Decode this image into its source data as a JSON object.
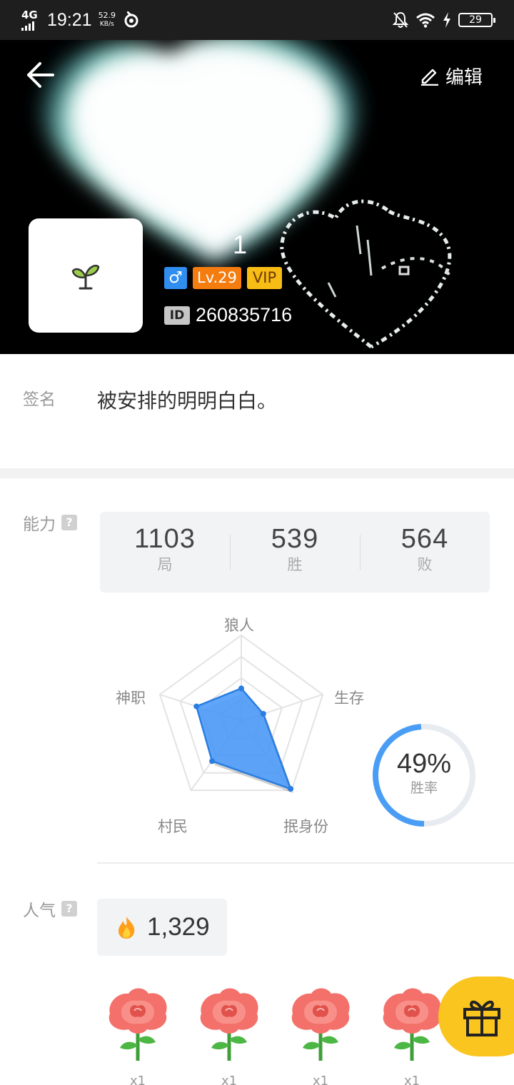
{
  "status_bar": {
    "network": "4G",
    "time": "19:21",
    "speed_value": "52.9",
    "speed_unit": "KB/s",
    "battery": "29",
    "icons": [
      "signal-icon",
      "swirl-icon",
      "mute-bell-icon",
      "wifi-icon",
      "charging-icon",
      "battery-icon"
    ]
  },
  "header": {
    "edit_label": "编辑",
    "nickname": "1",
    "gender_symbol": "♂",
    "level": "Lv.29",
    "vip": "VIP",
    "id_tag": "ID",
    "user_id": "260835716",
    "avatar_icon": "sprout-icon"
  },
  "signature": {
    "label": "签名",
    "text": "被安排的明明白白。"
  },
  "ability": {
    "label": "能力",
    "help": "?",
    "stats": [
      {
        "value": "1103",
        "unit": "局"
      },
      {
        "value": "539",
        "unit": "胜"
      },
      {
        "value": "564",
        "unit": "败"
      }
    ],
    "radar": {
      "axes": [
        "狼人",
        "生存",
        "抿身份",
        "村民",
        "神职"
      ],
      "values": [
        0.38,
        0.27,
        0.98,
        0.58,
        0.55
      ],
      "fill": "#4f9cf9",
      "stroke": "#2a7de1"
    },
    "win_rate": {
      "value": "49%",
      "label": "胜率",
      "fraction": 0.49,
      "color": "#4a9df5"
    }
  },
  "popularity": {
    "label": "人气",
    "help": "?",
    "value": "1,329",
    "icon": "fire-icon"
  },
  "gifts": [
    {
      "icon": "rose-icon",
      "count": "x1"
    },
    {
      "icon": "rose-icon",
      "count": "x1"
    },
    {
      "icon": "rose-icon",
      "count": "x1"
    },
    {
      "icon": "rose-icon",
      "count": "x1"
    }
  ],
  "fab_icon": "gift-icon"
}
